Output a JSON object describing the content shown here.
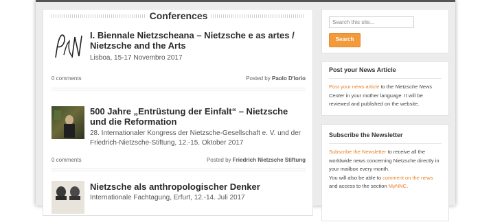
{
  "main": {
    "section_title": "Conferences",
    "posts": [
      {
        "title": "I. Biennale Nietzscheana – Nietzsche e as artes / Nietzsche and the Arts",
        "subtitle": "Lisboa, 15-17 Novembro 2017",
        "comments": "0 comments",
        "byline_prefix": "Posted by",
        "author": "Paolo D'Iorio",
        "thumb_icon": "signature-logo-icon"
      },
      {
        "title": "500 Jahre „Entrüstung der Einfalt“ – Nietzsche und die Reformation",
        "subtitle": "28. Internationaler Kongress der Nietzsche-Gesellschaft e. V. und der Friedrich-Nietzsche-Stiftung, 12.-15. Oktober 2017",
        "comments": "0 comments",
        "byline_prefix": "Posted by",
        "author": "Friedrich Nietzsche Stiftung",
        "thumb_icon": "painting-thumbnail"
      },
      {
        "title": "Nietzsche als anthropologischer Denker",
        "subtitle": "Internationale Fachtagung, Erfurt, 12.-14. Juli 2017",
        "thumb_icon": "portraits-thumbnail"
      }
    ]
  },
  "sidebar": {
    "search_placeholder": "Search this site...",
    "search_button": "Search",
    "news": {
      "title": "Post your News Article",
      "link": "Post your news article",
      "text1": " to the ",
      "em": "Nietzsche News Center",
      "text2": " in your mother language. It will be reviewed and published on the website."
    },
    "newsletter": {
      "title": "Subscribe the Newsletter",
      "link1": "Subscribe the Newsletter",
      "text1": " to receive all the worldwide news concerning Nietzsche directly in your mailbox every month.",
      "text2": "You will also be able to ",
      "link2": "comment on the news",
      "text3": " and access to the section ",
      "link3": "MyNNC",
      "text4": "."
    }
  },
  "colors": {
    "accent": "#f39a3c",
    "link": "#e8812a",
    "background": "#ececec"
  }
}
